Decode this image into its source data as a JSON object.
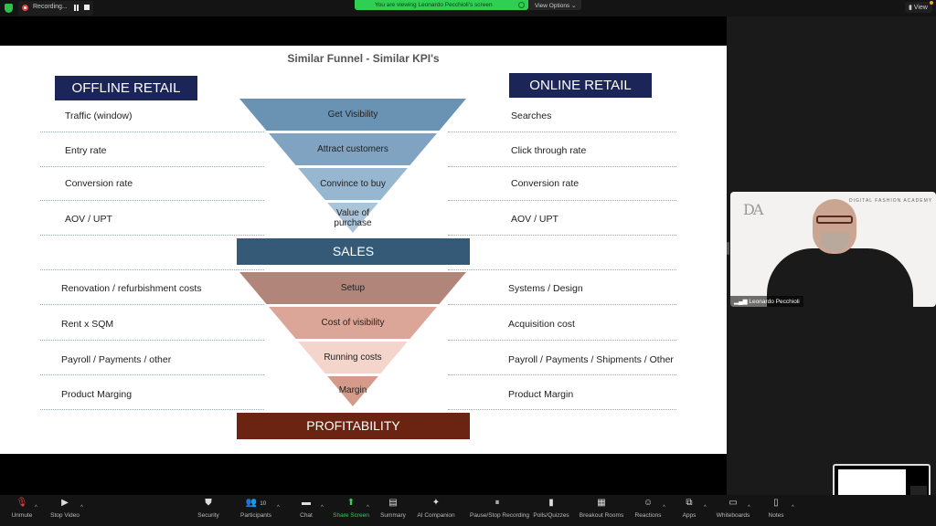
{
  "topbar": {
    "recording_label": "Recording...",
    "viewing_banner": "You are viewing Leonardo Pecchioli's screen",
    "view_options_label": "View Options",
    "view_button_label": "View"
  },
  "slide": {
    "title": "Similar Funnel - Similar KPI's",
    "offline_header": "OFFLINE RETAIL",
    "online_header": "ONLINE RETAIL",
    "offline_rows": [
      "Traffic (window)",
      "Entry rate",
      "Conversion rate",
      "AOV / UPT",
      "Renovation / refurbishment costs",
      "Rent x SQM",
      "Payroll / Payments / other",
      "Product Marging"
    ],
    "online_rows": [
      "Searches",
      "Click through rate",
      "Conversion rate",
      "AOV / UPT",
      "Systems / Design",
      "Acquisition cost",
      "Payroll / Payments / Shipments / Other",
      "Product Margin"
    ],
    "sales_funnel": [
      {
        "label": "Get Visibility",
        "color": "#6a92b2"
      },
      {
        "label": "Attract customers",
        "color": "#7fa3c0"
      },
      {
        "label": "Convince to buy",
        "color": "#97b6cf"
      },
      {
        "label": "Value of purchase",
        "color": "#aac4d9"
      }
    ],
    "sales_bar": {
      "label": "SALES",
      "color": "#355a78"
    },
    "cost_funnel": [
      {
        "label": "Setup",
        "color": "#b2857a"
      },
      {
        "label": "Cost of visibility",
        "color": "#dba697"
      },
      {
        "label": "Running costs",
        "color": "#f3d5cc"
      },
      {
        "label": "Margin",
        "color": "#d49a8a"
      }
    ],
    "profit_bar": {
      "label": "PROFITABILITY",
      "color": "#6b2412"
    }
  },
  "video": {
    "participant_name": "Leonardo Pecchioli",
    "logo_text": "DA",
    "backdrop_text": "DIGITAL FASHION ACADEMY"
  },
  "toolbar": {
    "items": [
      {
        "label": "Unmute",
        "icon": "muted-mic-icon"
      },
      {
        "label": "Stop Video",
        "icon": "video-camera-icon"
      },
      {
        "label": "Security",
        "icon": "shield-icon"
      },
      {
        "label": "Participants",
        "icon": "participants-icon",
        "count": "10"
      },
      {
        "label": "Chat",
        "icon": "chat-icon"
      },
      {
        "label": "Share Screen",
        "icon": "share-screen-icon"
      },
      {
        "label": "Summary",
        "icon": "summary-icon"
      },
      {
        "label": "AI Companion",
        "icon": "ai-sparkle-icon"
      },
      {
        "label": "Pause/Stop Recording",
        "icon": "pause-stop-recording-icon"
      },
      {
        "label": "Polls/Quizzes",
        "icon": "polls-icon"
      },
      {
        "label": "Breakout Rooms",
        "icon": "breakout-rooms-icon"
      },
      {
        "label": "Reactions",
        "icon": "reactions-icon"
      },
      {
        "label": "Apps",
        "icon": "apps-icon"
      },
      {
        "label": "Whiteboards",
        "icon": "whiteboard-icon"
      },
      {
        "label": "Notes",
        "icon": "notes-icon"
      }
    ]
  },
  "colors": {
    "header_navy": "#1b2558",
    "zoom_green": "#2fcf53",
    "toolbar_bg": "#141414"
  }
}
